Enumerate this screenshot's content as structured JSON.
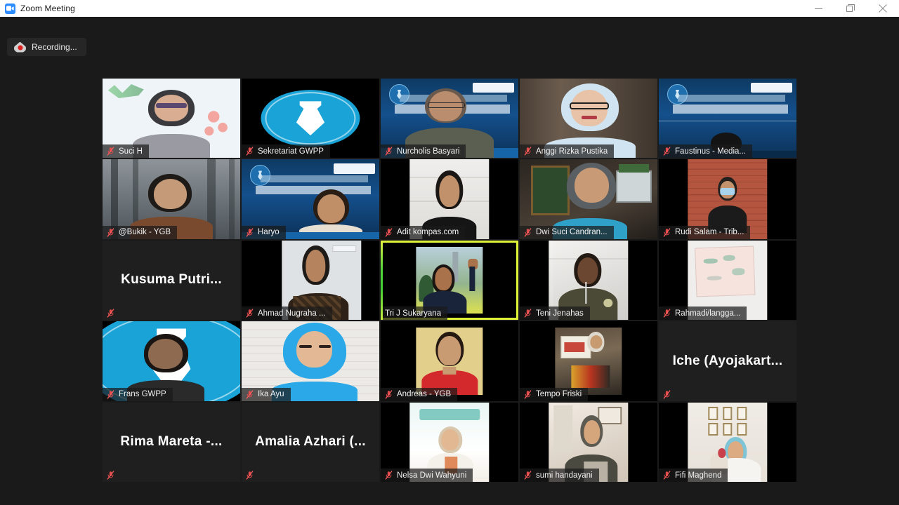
{
  "window": {
    "title": "Zoom Meeting",
    "app_icon": "zoom-camera-icon",
    "controls": {
      "minimize": "minimize-icon",
      "restore": "restore-icon",
      "close": "close-icon"
    }
  },
  "status": {
    "recording_label": "Recording...",
    "recording_icon": "recording-cloud-icon"
  },
  "gallery": {
    "columns": 5,
    "rows": 5,
    "active_speaker": "Tri J Sukaryana",
    "active_border_color": "#dff23a",
    "mute_icon": "microphone-muted-icon",
    "participants": [
      {
        "name": "Suci H",
        "video": true,
        "muted": true,
        "scene": "white",
        "style": "full"
      },
      {
        "name": "Sekretariat GWPP",
        "video": true,
        "muted": true,
        "scene": "gwpp-logo",
        "style": "square"
      },
      {
        "name": "Nurcholis Basyari",
        "video": true,
        "muted": true,
        "scene": "fellowship",
        "style": "full"
      },
      {
        "name": "Anggi Rizka Pustika",
        "video": true,
        "muted": true,
        "scene": "curtain",
        "style": "full"
      },
      {
        "name": "Faustinus - Media...",
        "video": true,
        "muted": true,
        "scene": "fellowship",
        "style": "full"
      },
      {
        "name": "@Bukik - YGB",
        "video": true,
        "muted": true,
        "scene": "forest",
        "style": "full"
      },
      {
        "name": "Haryo",
        "video": true,
        "muted": true,
        "scene": "fellowship",
        "style": "full"
      },
      {
        "name": "Adit kompas.com",
        "video": true,
        "muted": true,
        "scene": "whitewall",
        "style": "square"
      },
      {
        "name": "Dwi Suci Candran...",
        "video": true,
        "muted": true,
        "scene": "room",
        "style": "full"
      },
      {
        "name": "Rudi Salam - Trib...",
        "video": true,
        "muted": true,
        "scene": "brick",
        "style": "square"
      },
      {
        "name": "Kusuma Putri...",
        "video": false,
        "muted": true,
        "scene": "none",
        "style": "name-only"
      },
      {
        "name": "Ahmad Nugraha ...",
        "video": true,
        "muted": true,
        "scene": "office",
        "style": "square"
      },
      {
        "name": "Tri J Sukaryana",
        "video": true,
        "muted": false,
        "scene": "outdoor",
        "style": "square"
      },
      {
        "name": "Teni Jenahas",
        "video": true,
        "muted": true,
        "scene": "whiteroom",
        "style": "square"
      },
      {
        "name": "Rahmadi/langga...",
        "video": true,
        "muted": true,
        "scene": "paper",
        "style": "square"
      },
      {
        "name": "Frans GWPP",
        "video": true,
        "muted": true,
        "scene": "gwpp-bg",
        "style": "full"
      },
      {
        "name": "Ika Ayu",
        "video": true,
        "muted": true,
        "scene": "brickwhite",
        "style": "full"
      },
      {
        "name": "Andreas - YGB",
        "video": true,
        "muted": true,
        "scene": "portrait-yellow",
        "style": "square"
      },
      {
        "name": "Tempo Friski",
        "video": true,
        "muted": true,
        "scene": "indoor-dark",
        "style": "square"
      },
      {
        "name": "Iche (Ayojakart...",
        "video": false,
        "muted": true,
        "scene": "none",
        "style": "name-only"
      },
      {
        "name": "Rima Mareta -...",
        "video": false,
        "muted": true,
        "scene": "none",
        "style": "name-only"
      },
      {
        "name": "Amalia Azhari (...",
        "video": false,
        "muted": true,
        "scene": "none",
        "style": "name-only"
      },
      {
        "name": "Nelsa Dwi Wahyuni",
        "video": true,
        "muted": true,
        "scene": "wardah",
        "style": "square"
      },
      {
        "name": "sumi handayani",
        "video": true,
        "muted": true,
        "scene": "home",
        "style": "square"
      },
      {
        "name": "Fifi Maghend",
        "video": true,
        "muted": true,
        "scene": "frames",
        "style": "square"
      }
    ]
  }
}
